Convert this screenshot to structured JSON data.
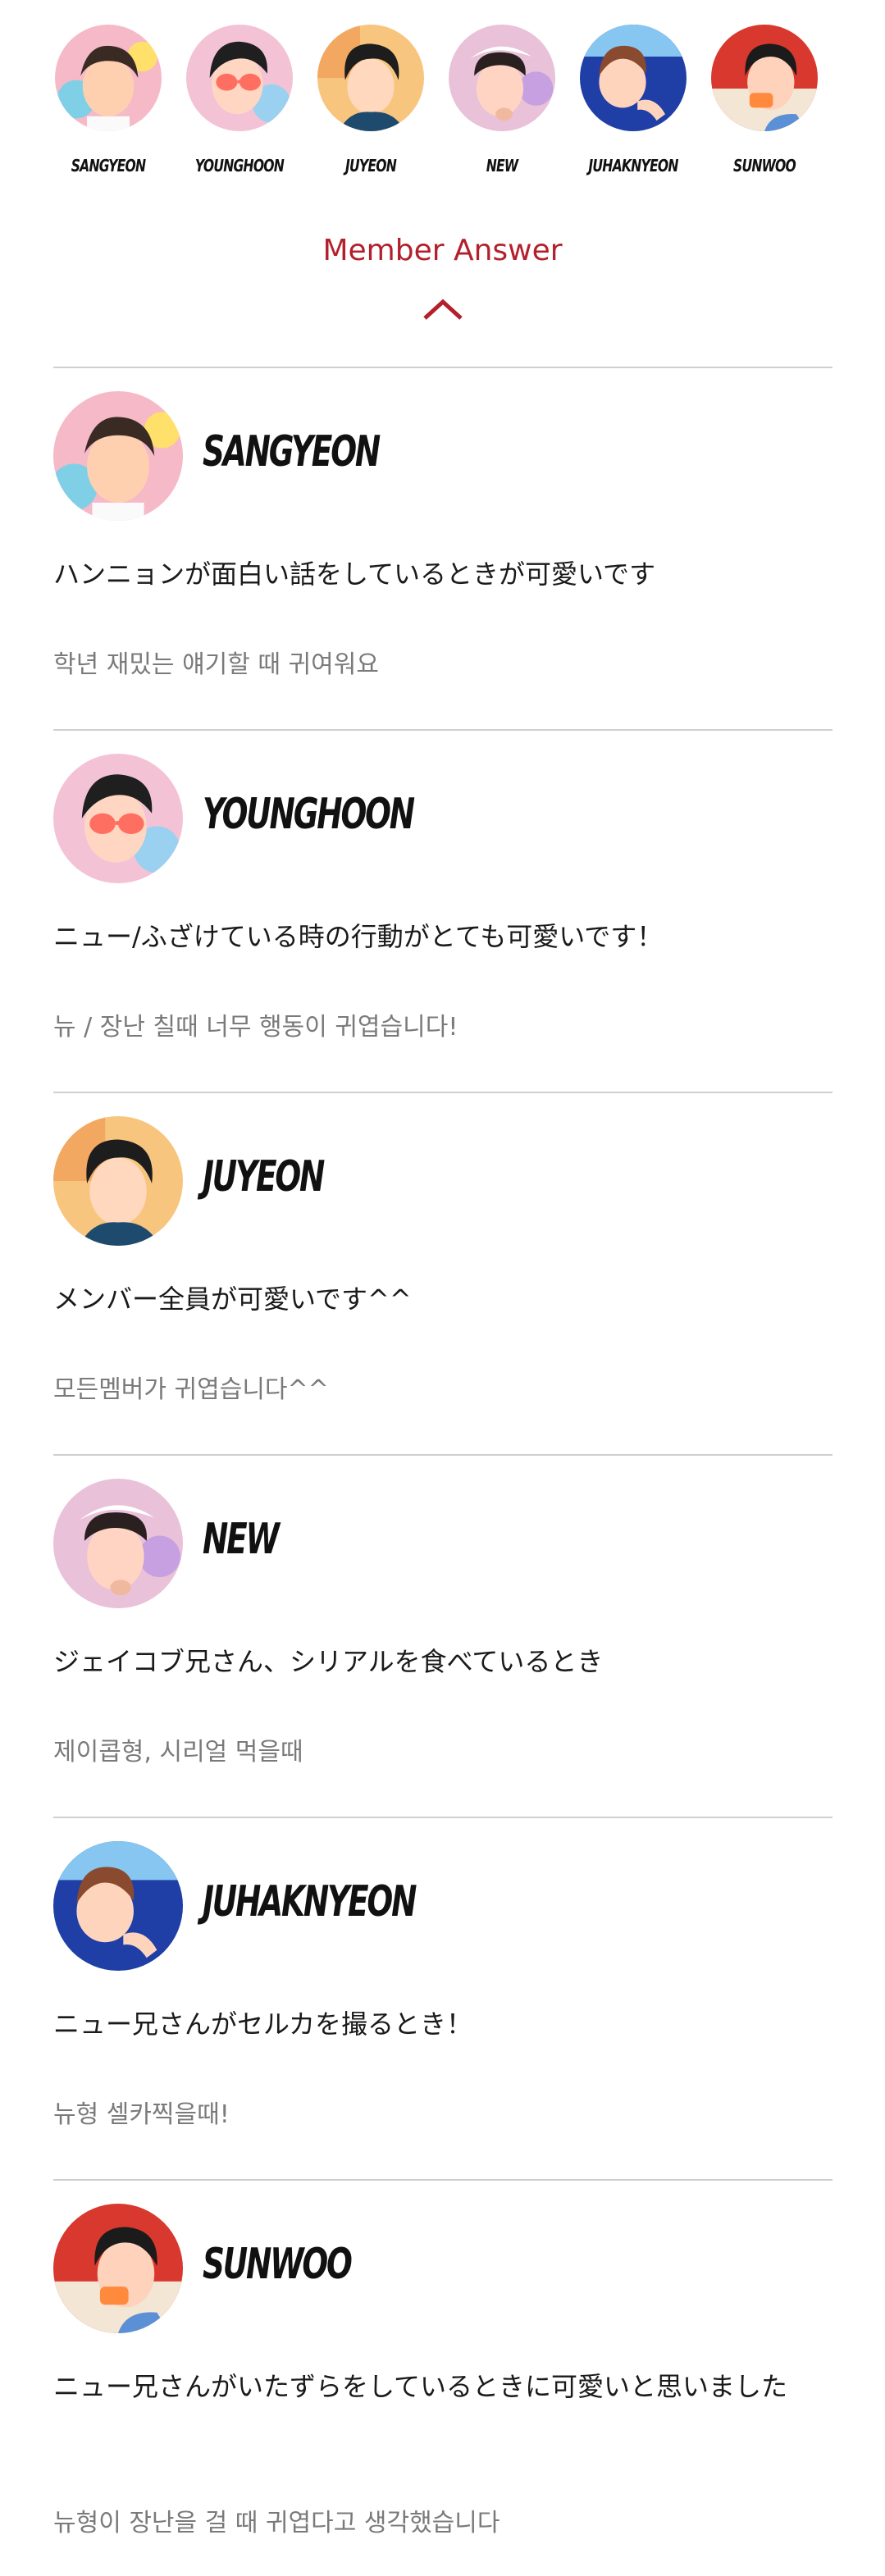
{
  "top_members": [
    {
      "name": "SANGYEON",
      "avatar_colors": [
        "#f6b9c8",
        "#3a2a24",
        "#ffd0b0"
      ]
    },
    {
      "name": "YOUNGHOON",
      "avatar_colors": [
        "#f3c3d5",
        "#1f1f1f",
        "#ff6f61"
      ]
    },
    {
      "name": "JUYEON",
      "avatar_colors": [
        "#f7c57e",
        "#1d1d1d",
        "#ffd8bd"
      ]
    },
    {
      "name": "NEW",
      "avatar_colors": [
        "#e9c1d9",
        "#ffffff",
        "#ffd4c3"
      ]
    },
    {
      "name": "JUHAKNYEON",
      "avatar_colors": [
        "#1f3fa6",
        "#8a4a2f",
        "#ffd4bd"
      ]
    },
    {
      "name": "SUNWOO",
      "avatar_colors": [
        "#d8382e",
        "#1b1b1b",
        "#ffd2bb"
      ]
    }
  ],
  "section": {
    "title": "Member Answer",
    "accent_color": "#b3202c",
    "collapse_icon": "chevron-up-icon"
  },
  "answers": [
    {
      "name": "SANGYEON",
      "jp": "ハンニョンが面白い話をしているときが可愛いです",
      "kr": "학년 재밌는 얘기할 때 귀여워요"
    },
    {
      "name": "YOUNGHOON",
      "jp": "ニュー/ふざけている時の行動がとても可愛いです！",
      "kr": "뉴 / 장난 칠때 너무 행동이 귀엽습니다!"
    },
    {
      "name": "JUYEON",
      "jp": "メンバー全員が可愛いです^^",
      "kr": "모든멤버가 귀엽습니다^^"
    },
    {
      "name": "NEW",
      "jp": "ジェイコブ兄さん、シリアルを食べているとき",
      "kr": "제이콥형, 시리얼 먹을때"
    },
    {
      "name": "JUHAKNYEON",
      "jp": "ニュー兄さんがセルカを撮るとき！",
      "kr": "뉴형 셀카찍을때!"
    },
    {
      "name": "SUNWOO",
      "jp": "ニュー兄さんがいたずらをしているときに可愛いと思いました",
      "kr": "뉴형이 장난을 걸 때 귀엽다고 생각했습니다"
    }
  ]
}
